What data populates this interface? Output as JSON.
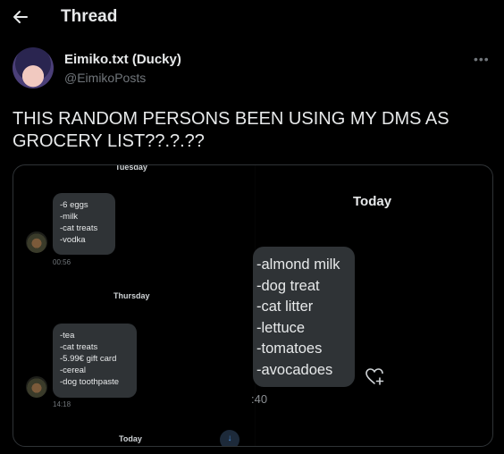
{
  "header": {
    "title": "Thread",
    "back_icon": "arrow-left-icon"
  },
  "author": {
    "name": "Eimiko.txt (Ducky)",
    "handle": "@EimikoPosts",
    "more_icon": "more-horizontal-icon"
  },
  "tweet": {
    "text": "THIS RANDOM PERSONS BEEN USING MY DMS AS GROCERY LIST??.?.??"
  },
  "screenshot": {
    "left": {
      "day_top": "Tuesday",
      "bubble1": {
        "lines": [
          "-6 eggs",
          "-milk",
          "-cat treats",
          "-vodka"
        ],
        "time": "00:56"
      },
      "day_mid": "Thursday",
      "bubble2": {
        "lines": [
          "-tea",
          "-cat treats",
          "-5.99€ gift card",
          "-cereal",
          "-dog toothpaste"
        ],
        "time": "14:18"
      },
      "day_bottom": "Today"
    },
    "right": {
      "day": "Today",
      "bubble": {
        "lines": [
          "-almond milk",
          "-dog treat",
          "-cat litter",
          "-lettuce",
          "-tomatoes",
          "-avocadoes"
        ],
        "time": ":40"
      },
      "react_icon": "heart-plus-icon"
    },
    "scroll_icon": "arrow-down-icon"
  }
}
